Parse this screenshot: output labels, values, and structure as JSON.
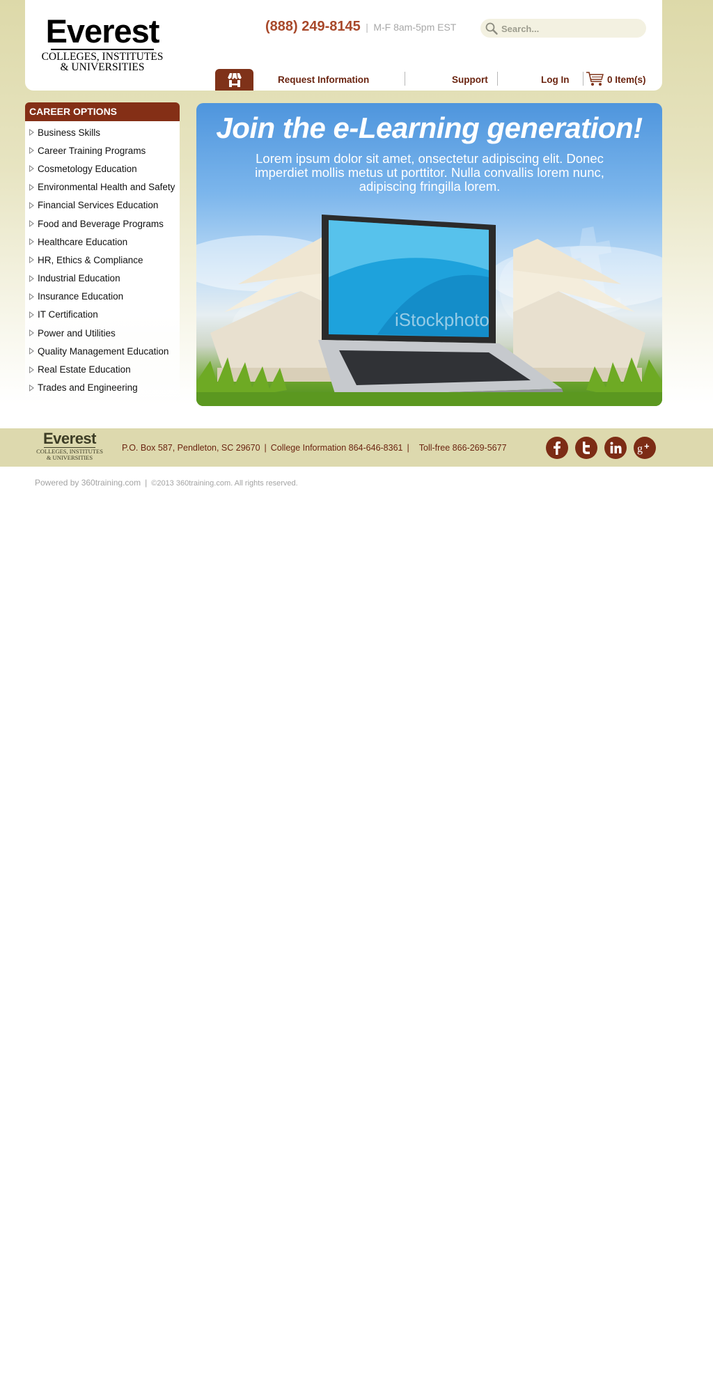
{
  "header": {
    "logo": {
      "main": "Everest",
      "sub_line1": "COLLEGES, INSTITUTES",
      "sub_line2": "& UNIVERSITIES"
    },
    "phone": {
      "number": "(888) 249-8145",
      "separator": "|",
      "hours": "M-F 8am-5pm EST"
    },
    "search": {
      "placeholder": "Search...",
      "icon": "search-icon"
    },
    "nav": {
      "home_icon": "storefront-icon",
      "items": [
        "Request Information",
        "Support",
        "Log In"
      ],
      "cart_icon": "cart-icon",
      "cart_label": "0 Item(s)"
    }
  },
  "sidebar": {
    "title": "CAREER OPTIONS",
    "items": [
      "Business Skills",
      "Career Training Programs",
      "Cosmetology Education",
      "Environmental Health and Safety",
      "Financial Services Education",
      "Food and Beverage Programs",
      "Healthcare Education",
      "HR, Ethics & Compliance",
      "Industrial Education",
      "Insurance Education",
      "IT Certification",
      "Power and Utilities",
      "Quality Management Education",
      "Real Estate Education",
      "Trades and Engineering"
    ]
  },
  "hero": {
    "title": "Join the e-Learning generation!",
    "text": "Lorem ipsum dolor sit amet, onsectetur adipiscing elit. Donec imperdiet mollis metus ut porttitor. Nulla convallis lorem nunc, adipiscing fringilla lorem.",
    "watermark": "iStockphoto"
  },
  "footer": {
    "logo": {
      "main": "Everest",
      "sub_line1": "COLLEGES, INSTITUTES",
      "sub_line2": "& UNIVERSITIES"
    },
    "address": "P.O. Box 587, Pendleton, SC 29670",
    "college_info": "College Information 864-646-8361",
    "tollfree": "Toll-free 866-269-5677",
    "separator": "|",
    "social": [
      "facebook-icon",
      "twitter-icon",
      "linkedin-icon",
      "google-plus-icon"
    ],
    "powered_by": "Powered by 360training.com",
    "copyright": "©2013 360training.com. All rights reserved."
  },
  "colors": {
    "accent": "#842f16",
    "brand_text": "#6b2511",
    "phone": "#a8492b",
    "footer_band": "#ddd9ae"
  }
}
